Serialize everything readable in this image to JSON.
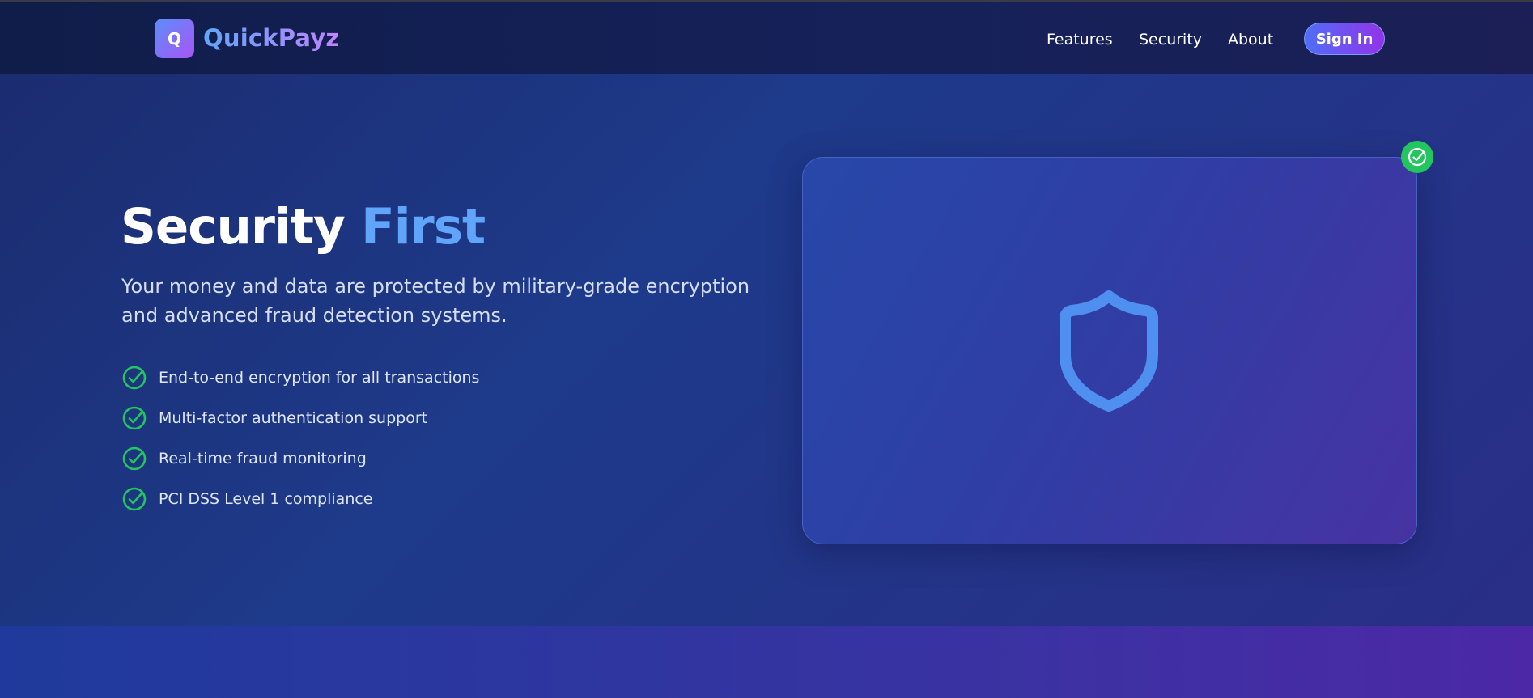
{
  "brand": {
    "logo_letter": "Q",
    "name": "QuickPayz"
  },
  "nav": {
    "items": [
      {
        "label": "Features"
      },
      {
        "label": "Security"
      },
      {
        "label": "About"
      }
    ],
    "signin_label": "Sign In"
  },
  "hero": {
    "title_main": "Security",
    "title_accent": "First",
    "subtitle": "Your money and data are protected by military-grade encryption and advanced fraud detection systems.",
    "features": [
      {
        "label": "End-to-end encryption for all transactions",
        "icon": "check-circle-icon"
      },
      {
        "label": "Multi-factor authentication support",
        "icon": "check-circle-icon"
      },
      {
        "label": "Real-time fraud monitoring",
        "icon": "check-circle-icon"
      },
      {
        "label": "PCI DSS Level 1 compliance",
        "icon": "check-circle-icon"
      }
    ]
  },
  "illustration": {
    "icon": "shield-icon",
    "badge_icon": "check-circle-icon"
  },
  "colors": {
    "accent_blue": "#60a5fa",
    "success_green": "#22c55e",
    "brand_purple": "#a855f7"
  }
}
